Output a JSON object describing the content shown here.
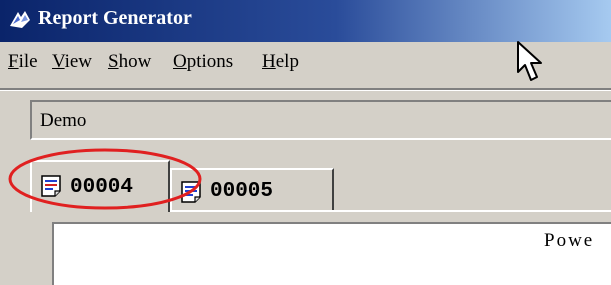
{
  "window": {
    "title": "Report Generator",
    "icon": "app-logo-icon"
  },
  "menu": {
    "items": [
      {
        "accel": "F",
        "rest": "ile"
      },
      {
        "accel": "V",
        "rest": "iew"
      },
      {
        "accel": "S",
        "rest": "how"
      },
      {
        "accel": "O",
        "rest": "ptions"
      },
      {
        "accel": "H",
        "rest": "elp"
      }
    ]
  },
  "combo": {
    "value": "Demo"
  },
  "tabs": [
    {
      "label": "00004",
      "icon": "document-icon",
      "active": true
    },
    {
      "label": "00005",
      "icon": "document-icon",
      "active": false
    }
  ],
  "content": {
    "text": "Powe"
  },
  "colors": {
    "titlebar_start": "#0a246a",
    "titlebar_end": "#a6caf0",
    "annotation": "#e02020",
    "face": "#d4d0c8"
  }
}
